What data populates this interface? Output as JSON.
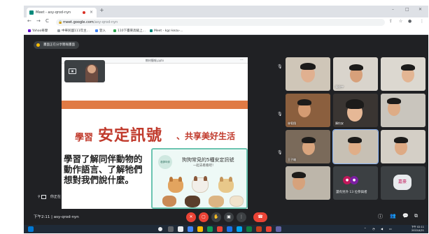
{
  "browser": {
    "tab": {
      "title": "Meet - asy-qrod-nyn",
      "close": "×"
    },
    "new_tab": "+",
    "window": {
      "minimize": "–",
      "maximize": "□",
      "close": "✕"
    },
    "nav": {
      "back": "←",
      "forward": "→",
      "reload": "C"
    },
    "url_host": "meet.google.com",
    "url_path": "/asy-qrod-nyn",
    "bookmarks": [
      {
        "label": "Yahoo奇摩",
        "color": "#6001d2"
      },
      {
        "label": "中華民國111年主...",
        "color": "#9aa0a6"
      },
      {
        "label": "登入",
        "color": "#4285f4"
      },
      {
        "label": "110下臺東高級上...",
        "color": "#34a853"
      },
      {
        "label": "Meet - kgc-kezu-...",
        "color": "#00897b"
      }
    ]
  },
  "notice": {
    "text": "畫面正在分享簡報畫面"
  },
  "presentation": {
    "header": "教材簡報.pptx",
    "title_left": "學習",
    "title_main": "安定訊號",
    "title_right": "、共享美好生活",
    "body": "學習了解同伴動物的動作語言、了解牠們想對我們說什麼。",
    "card_title": "狗狗常見的5種安定訊號",
    "card_sub": "一起去看看吧！",
    "card_logo": "老師叫你",
    "presenter_label": "你正在"
  },
  "participants": [
    {
      "name": ""
    },
    {
      "name": "陳俊宇"
    },
    {
      "name": ""
    },
    {
      "name": ""
    },
    {
      "name": ""
    },
    {
      "name": ""
    },
    {
      "name": "林宥翔"
    },
    {
      "name": "陳怡安"
    },
    {
      "name": ""
    },
    {
      "name": "王子瑜"
    },
    {
      "name": ""
    },
    {
      "name": ""
    },
    {
      "name": ""
    },
    {
      "name": "還有另外 13 位參與者"
    },
    {
      "name": "嘉豪"
    }
  ],
  "others": {
    "text": "還有另外 13 位參與者",
    "avatar": "嘉豪"
  },
  "meeting_bar": {
    "time": "下午2:11",
    "separator": "|",
    "code": "asy-qrod-nyn"
  },
  "taskbar": {
    "time": "下午 02:11",
    "date": "2022/4/21"
  },
  "colors": {
    "meet_bg": "#202124",
    "accent_red": "#ea4335",
    "slide_title": "#c0392b",
    "slide_band": "#e07a44",
    "card_border": "#6bc4b0"
  }
}
